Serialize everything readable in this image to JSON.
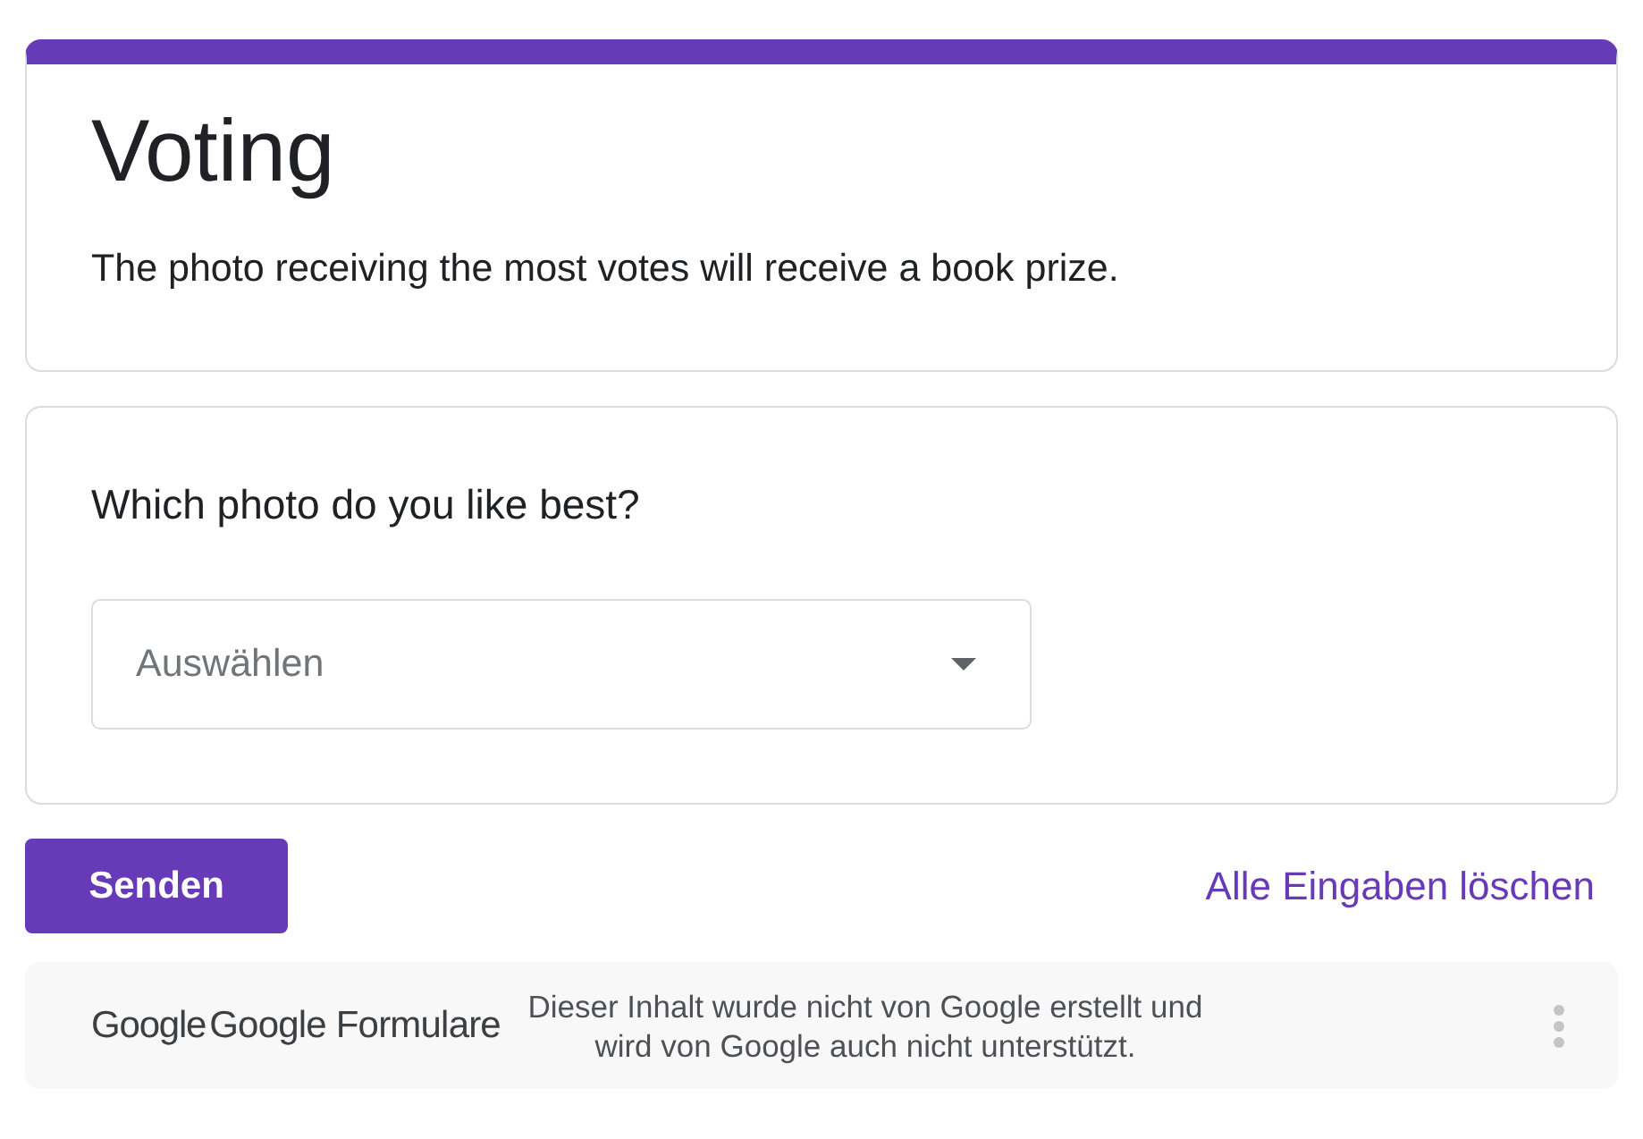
{
  "header": {
    "title": "Voting",
    "description": "The photo receiving the most votes will receive a book prize."
  },
  "questions": [
    {
      "kind": "dropdown",
      "title": "Which photo do you like best?",
      "placeholder": "Auswählen"
    }
  ],
  "actions": {
    "submit": "Senden",
    "clear": "Alle Eingaben löschen"
  },
  "footer": {
    "logo": "Google",
    "product": "Google Formulare",
    "disclaimer": "Dieser Inhalt wurde nicht von Google erstellt und wird von Google auch nicht unterstützt."
  }
}
